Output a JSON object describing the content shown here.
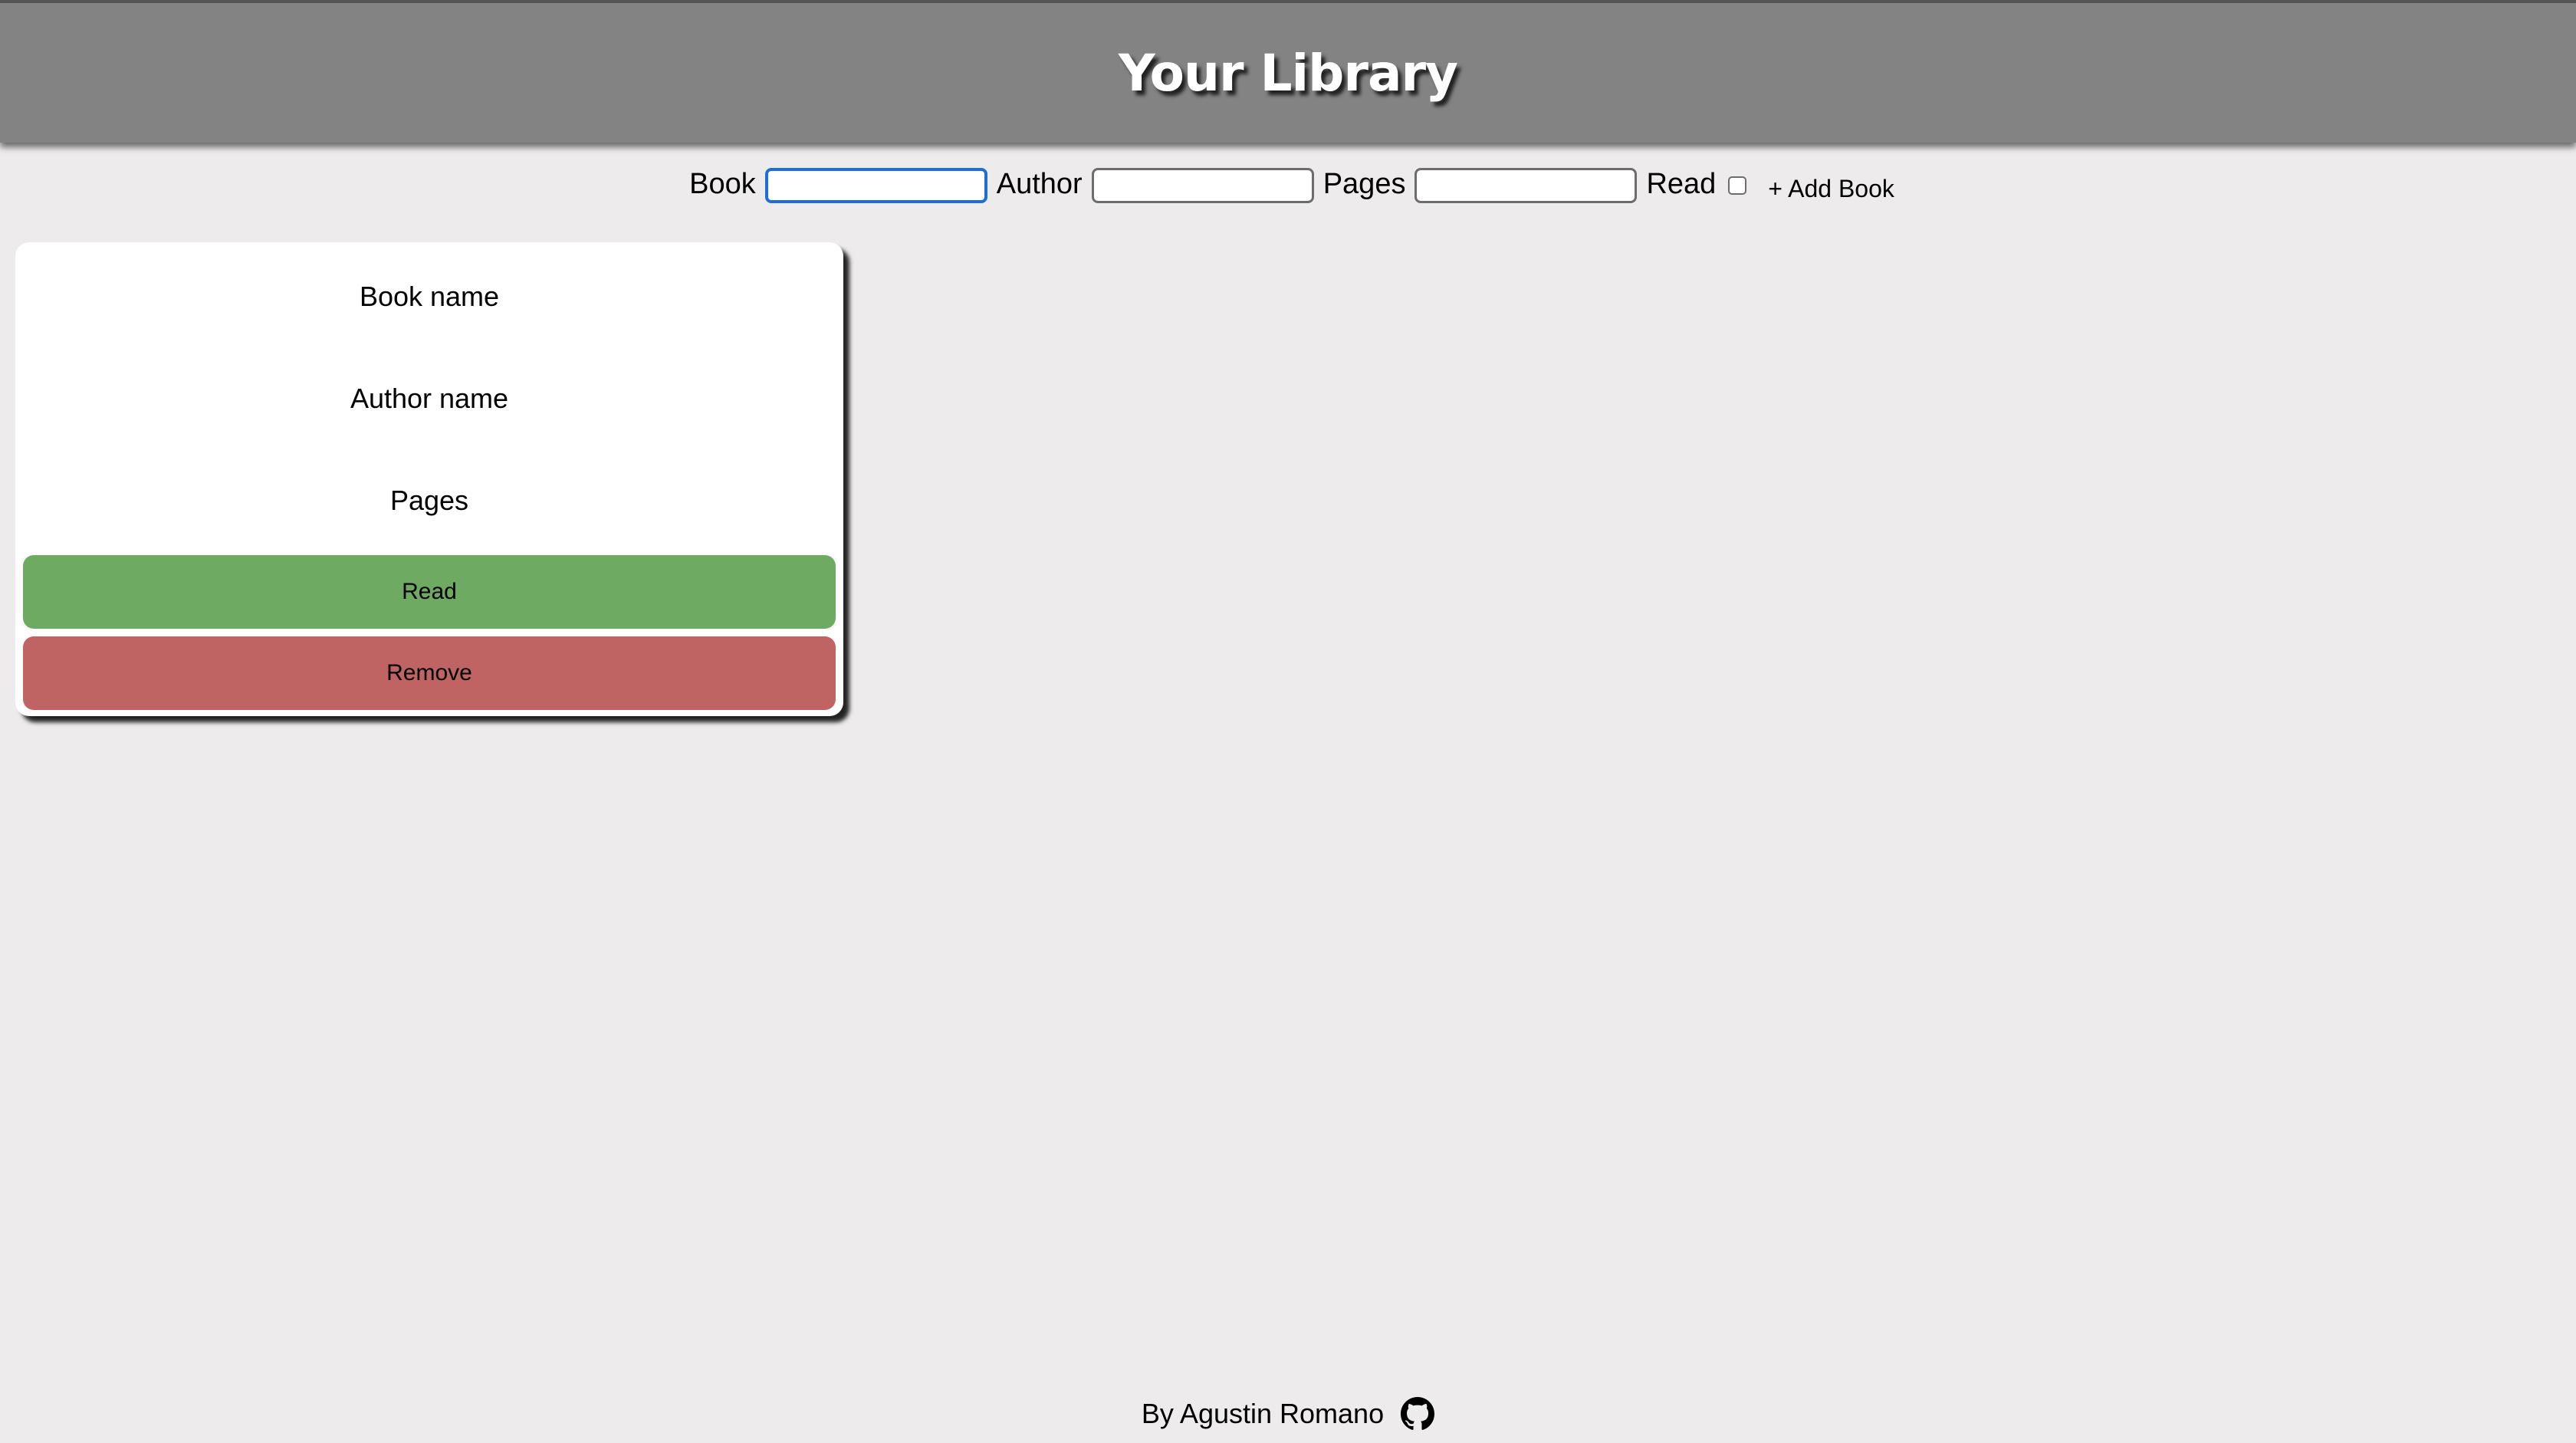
{
  "header": {
    "title": "Your Library"
  },
  "form": {
    "book_label": "Book",
    "author_label": "Author",
    "pages_label": "Pages",
    "read_label": "Read",
    "add_button_label": "+ Add Book",
    "book_value": "",
    "author_value": "",
    "pages_value": "",
    "read_checked": false
  },
  "books": [
    {
      "title": "Book name",
      "author": "Author name",
      "pages": "Pages",
      "read_label": "Read",
      "remove_label": "Remove"
    }
  ],
  "footer": {
    "credit": "By Agustin Romano",
    "icon": "github-icon"
  },
  "colors": {
    "header_bg": "#838383",
    "page_bg": "#edebec",
    "read_button": "#6eaa61",
    "remove_button": "#bf6462",
    "focus_border": "#1a6fd8"
  }
}
